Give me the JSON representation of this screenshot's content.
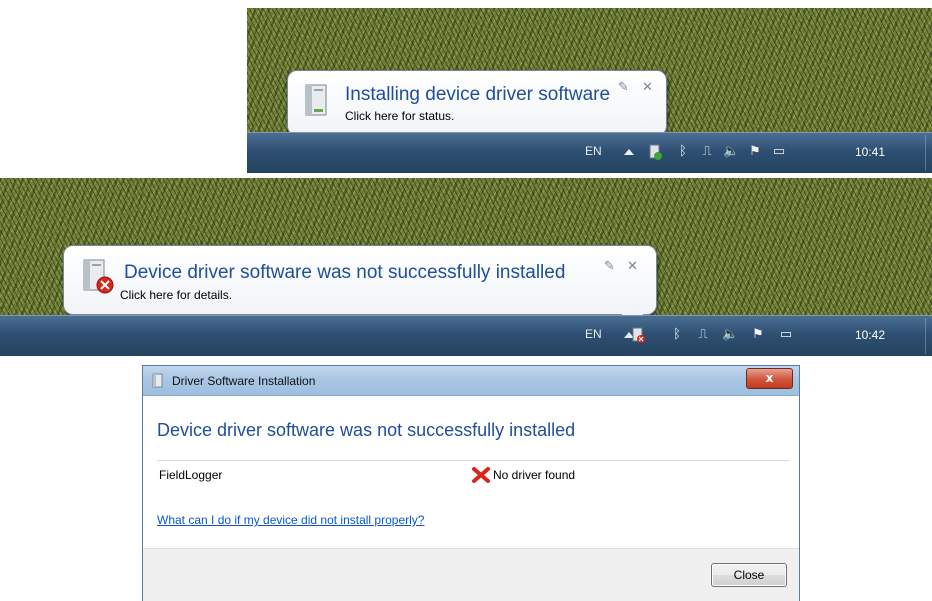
{
  "panel1": {
    "balloon_title": "Installing device driver software",
    "balloon_text": "Click here for status.",
    "lang": "EN",
    "clock": "10:41"
  },
  "panel2": {
    "balloon_title": "Device driver software was not successfully installed",
    "balloon_text": "Click here for details.",
    "lang": "EN",
    "clock": "10:42"
  },
  "dialog": {
    "window_title": "Driver Software Installation",
    "close_glyph": "x",
    "heading": "Device driver software was not successfully installed",
    "device_name": "FieldLogger",
    "device_status": "No driver found",
    "help_link": "What can I do if my device did not install properly?",
    "close_button": "Close"
  },
  "icons": {
    "balloon_options": "wrench-icon",
    "balloon_close": "close-icon",
    "tray": [
      "show-hidden-icons-arrow",
      "device-installing-icon",
      "bluetooth-icon",
      "network-icon",
      "volume-icon",
      "action-center-flag-icon",
      "display-icon"
    ]
  },
  "colors": {
    "accent_blue": "#1f4e9a",
    "link_blue": "#0a58c8",
    "error_red": "#d9261c",
    "taskbar": "#2e4f72"
  }
}
